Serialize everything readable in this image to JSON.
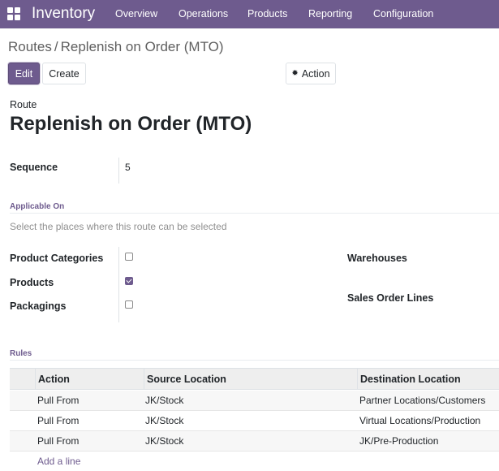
{
  "navbar": {
    "app_name": "Inventory",
    "menu": [
      "Overview",
      "Operations",
      "Products",
      "Reporting",
      "Configuration"
    ]
  },
  "breadcrumb": {
    "parent": "Routes",
    "separator": "/",
    "current": "Replenish on Order (MTO)"
  },
  "toolbar": {
    "edit_label": "Edit",
    "create_label": "Create",
    "action_label": "Action",
    "action_icon": "gear-icon"
  },
  "form": {
    "route_label": "Route",
    "route_name": "Replenish on Order (MTO)",
    "sequence_label": "Sequence",
    "sequence_value": "5"
  },
  "applicable_on": {
    "title": "Applicable On",
    "help": "Select the places where this route can be selected",
    "options": [
      {
        "label": "Product Categories",
        "checked": false
      },
      {
        "label": "Products",
        "checked": true
      },
      {
        "label": "Packagings",
        "checked": false
      }
    ],
    "warehouses_label": "Warehouses",
    "sales_order_lines_label": "Sales Order Lines"
  },
  "rules": {
    "title": "Rules",
    "columns": [
      "Action",
      "Source Location",
      "Destination Location"
    ],
    "rows": [
      [
        "Pull From",
        "JK/Stock",
        "Partner Locations/Customers"
      ],
      [
        "Pull From",
        "JK/Stock",
        "Virtual Locations/Production"
      ],
      [
        "Pull From",
        "JK/Stock",
        "JK/Pre-Production"
      ]
    ],
    "add_line_label": "Add a line"
  },
  "colors": {
    "brand": "#6e5b8e",
    "navbar_text": "#ffffff",
    "muted_text": "#8f8f8f"
  }
}
